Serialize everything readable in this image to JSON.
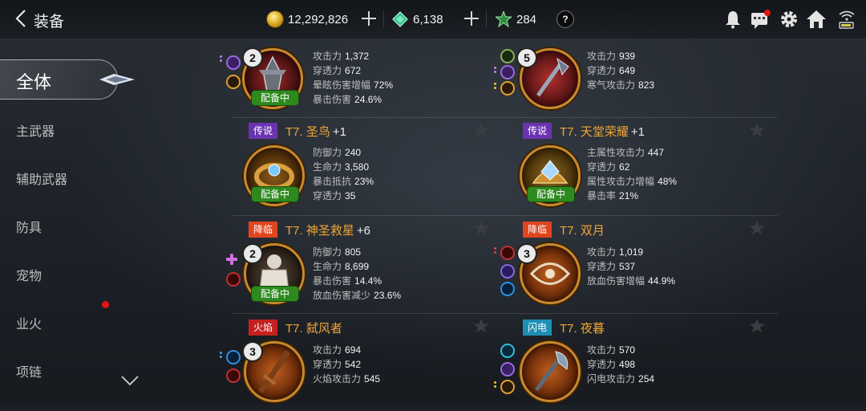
{
  "header": {
    "title": "装备",
    "gold": "12,292,826",
    "gems": "6,138",
    "tokens": "284",
    "help": "?"
  },
  "sidebar": {
    "active": "全体",
    "items": [
      "主武器",
      "辅助武器",
      "防具",
      "宠物",
      "业火",
      "项链"
    ]
  },
  "colors": {
    "accent": "#f0a434",
    "equipped": "#2e8a1f",
    "legend": "#6a34b0",
    "descent": "#e0451e",
    "fire": "#c42020",
    "lightning": "#1e8fb5"
  },
  "items": [
    {
      "name": "",
      "plus": "",
      "tag": "",
      "level": "2",
      "equipped": "配备中",
      "stats": [
        {
          "k": "攻击力",
          "v": "1,372"
        },
        {
          "k": "穿透力",
          "v": "672"
        },
        {
          "k": "晕眩伤害增幅",
          "v": "72%"
        },
        {
          "k": "暴击伤害",
          "v": "24.6%"
        }
      ]
    },
    {
      "name": "",
      "plus": "",
      "tag": "",
      "level": "5",
      "equipped": "",
      "stats": [
        {
          "k": "攻击力",
          "v": "939"
        },
        {
          "k": "穿透力",
          "v": "649"
        },
        {
          "k": "寒气攻击力",
          "v": "823"
        }
      ]
    },
    {
      "name": "T7. 圣鸟",
      "plus": "+1",
      "tag": "传说",
      "level": "",
      "equipped": "配备中",
      "stats": [
        {
          "k": "防御力",
          "v": "240"
        },
        {
          "k": "生命力",
          "v": "3,580"
        },
        {
          "k": "暴击抵抗",
          "v": "23%"
        },
        {
          "k": "穿透力",
          "v": "35"
        }
      ]
    },
    {
      "name": "T7. 天堂荣耀",
      "plus": "+1",
      "tag": "传说",
      "level": "",
      "equipped": "配备中",
      "stats": [
        {
          "k": "主属性攻击力",
          "v": "447"
        },
        {
          "k": "穿透力",
          "v": "62"
        },
        {
          "k": "属性攻击力增幅",
          "v": "48%"
        },
        {
          "k": "暴击率",
          "v": "21%"
        }
      ]
    },
    {
      "name": "T7. 神圣救星",
      "plus": "+6",
      "tag": "降临",
      "level": "2",
      "equipped": "配备中",
      "stats": [
        {
          "k": "防御力",
          "v": "805"
        },
        {
          "k": "生命力",
          "v": "8,699"
        },
        {
          "k": "暴击伤害",
          "v": "14.4%"
        },
        {
          "k": "放血伤害减少",
          "v": "23.6%"
        }
      ]
    },
    {
      "name": "T7. 双月",
      "plus": "",
      "tag": "降临",
      "level": "3",
      "equipped": "",
      "stats": [
        {
          "k": "攻击力",
          "v": "1,019"
        },
        {
          "k": "穿透力",
          "v": "537"
        },
        {
          "k": "放血伤害增幅",
          "v": "44.9%"
        }
      ]
    },
    {
      "name": "T7. 弑风者",
      "plus": "",
      "tag": "火焰",
      "level": "3",
      "equipped": "",
      "stats": [
        {
          "k": "攻击力",
          "v": "694"
        },
        {
          "k": "穿透力",
          "v": "542"
        },
        {
          "k": "火焰攻击力",
          "v": "545"
        }
      ]
    },
    {
      "name": "T7. 夜暮",
      "plus": "",
      "tag": "闪电",
      "level": "",
      "equipped": "",
      "stats": [
        {
          "k": "攻击力",
          "v": "570"
        },
        {
          "k": "穿透力",
          "v": "498"
        },
        {
          "k": "闪电攻击力",
          "v": "254"
        }
      ]
    }
  ]
}
